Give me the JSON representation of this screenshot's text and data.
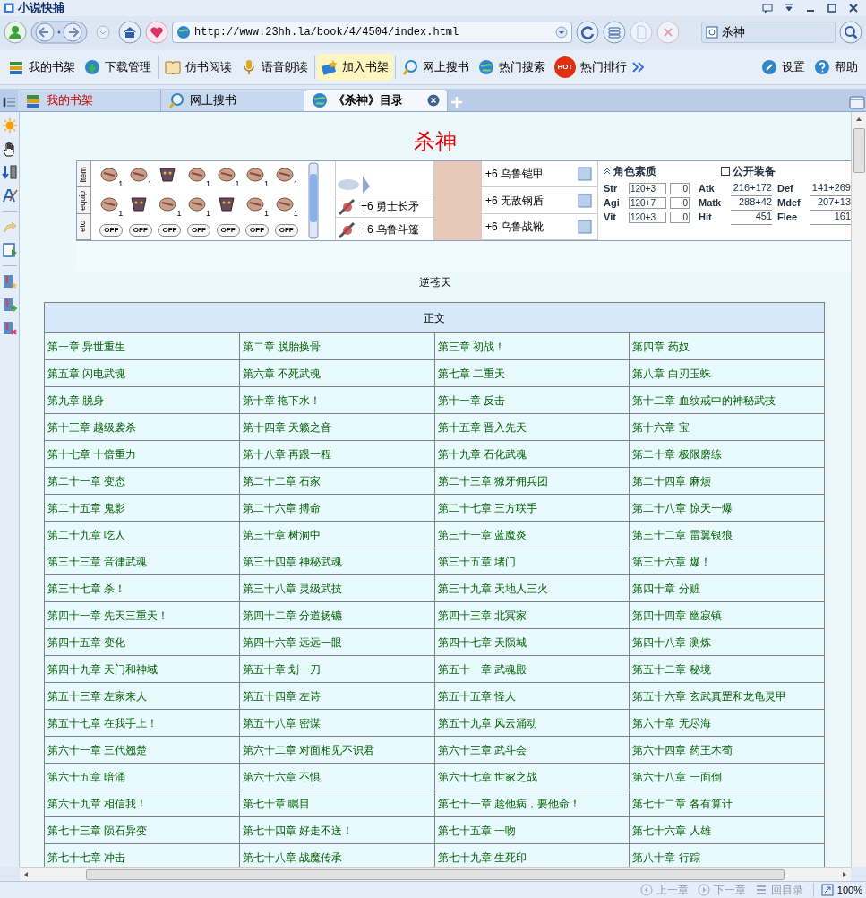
{
  "window": {
    "title": "小说快捕"
  },
  "nav": {
    "url": "http://www.23hh.la/book/4/4504/index.html",
    "search_value": "杀神"
  },
  "toolbar": {
    "left": [
      {
        "label": "我的书架",
        "kind": "books",
        "highlighted": false
      },
      {
        "label": "下载管理",
        "kind": "download",
        "highlighted": false
      },
      {
        "label": "仿书阅读",
        "kind": "reader",
        "highlighted": false
      },
      {
        "label": "语音朗读",
        "kind": "voice",
        "highlighted": false
      },
      {
        "label": "加入书架",
        "kind": "add",
        "highlighted": true
      },
      {
        "label": "网上搜书",
        "kind": "search",
        "highlighted": false
      },
      {
        "label": "热门搜索",
        "kind": "globe",
        "highlighted": false
      },
      {
        "label": "热门排行",
        "kind": "hot",
        "badge": "HOT",
        "highlighted": false
      }
    ],
    "right": [
      {
        "label": "设置",
        "kind": "settings"
      },
      {
        "label": "帮助",
        "kind": "help"
      }
    ]
  },
  "tabs": [
    {
      "label": "我的书架",
      "kind": "books",
      "selected": false,
      "color": "#d40000"
    },
    {
      "label": "网上搜书",
      "kind": "search",
      "selected": false
    },
    {
      "label": "《杀神》目录",
      "kind": "globe",
      "selected": true
    }
  ],
  "page": {
    "title": "杀神",
    "banner": {
      "side_tabs": [
        "item",
        "equip",
        "etc"
      ],
      "slots": [
        [
          {
            "kind": "stack",
            "count": "1"
          },
          {
            "kind": "stack",
            "count": "1"
          },
          {
            "kind": "single"
          },
          {
            "kind": "stack",
            "count": "1"
          },
          {
            "kind": "stack",
            "count": "1"
          },
          {
            "kind": "stack",
            "count": "1"
          },
          {
            "kind": "stack",
            "count": "1"
          }
        ],
        [
          {
            "kind": "stack",
            "count": "1"
          },
          {
            "kind": "single"
          },
          {
            "kind": "stack",
            "count": "1"
          },
          {
            "kind": "stack",
            "count": "1"
          },
          {
            "kind": "single"
          },
          {
            "kind": "stack",
            "count": "1"
          },
          {
            "kind": "stack",
            "count": "1"
          }
        ]
      ],
      "off_buttons": [
        "OFF",
        "OFF",
        "OFF",
        "OFF",
        "OFF",
        "OFF",
        "OFF"
      ],
      "left_gear": [
        "+6 勇士长矛",
        "+6 乌鲁斗篷"
      ],
      "right_gear": [
        "+6 乌鲁铠甲",
        "+6 无敌钢盾",
        "+6 乌鲁战靴"
      ],
      "stats_title": "角色素质",
      "public_label": "公开装备",
      "base_stats": [
        {
          "name": "Str",
          "value": "120+3",
          "bonus": "0"
        },
        {
          "name": "Agi",
          "value": "120+7",
          "bonus": "0"
        },
        {
          "name": "Vit",
          "value": "120+3",
          "bonus": "0"
        }
      ],
      "derived_stats": [
        [
          {
            "name": "Atk",
            "value": "216+172"
          },
          {
            "name": "Def",
            "value": "141+269"
          }
        ],
        [
          {
            "name": "Matk",
            "value": "288+42"
          },
          {
            "name": "Mdef",
            "value": "207+13"
          }
        ],
        [
          {
            "name": "Hit",
            "value": "451"
          },
          {
            "name": "Flee",
            "value": "161"
          }
        ]
      ]
    },
    "author": "逆苍天",
    "table": {
      "heading": "正文",
      "rows": [
        [
          "第一章 异世重生",
          "第二章 脱胎换骨",
          "第三章 初战！",
          "第四章 药奴"
        ],
        [
          "第五章 闪电武魂",
          "第六章 不死武魂",
          "第七章 二重天",
          "第八章 白刃玉蛛"
        ],
        [
          "第九章 脱身",
          "第十章 拖下水！",
          "第十一章 反击",
          "第十二章 血纹戒中的神秘武技"
        ],
        [
          "第十三章 越级袭杀",
          "第十四章 天籁之音",
          "第十五章 晋入先天",
          "第十六章 宝"
        ],
        [
          "第十七章 十倍重力",
          "第十八章 再跟一程",
          "第十九章 石化武魂",
          "第二十章 极限磨练"
        ],
        [
          "第二十一章 变态",
          "第二十二章 石家",
          "第二十三章 獠牙佣兵团",
          "第二十四章 麻烦"
        ],
        [
          "第二十五章 鬼影",
          "第二十六章 搏命",
          "第二十七章 三方联手",
          "第二十八章 惊天一爆"
        ],
        [
          "第二十九章 吃人",
          "第三十章 树洞中",
          "第三十一章 蓝魔炎",
          "第三十二章 雷翼银狼"
        ],
        [
          "第三十三章 音律武魂",
          "第三十四章 神秘武魂",
          "第三十五章 堵门",
          "第三十六章 爆！"
        ],
        [
          "第三十七章 杀！",
          "第三十八章 灵级武技",
          "第三十九章 天地人三火",
          "第四十章 分赃"
        ],
        [
          "第四十一章 先天三重天！",
          "第四十二章 分道扬镳",
          "第四十三章 北冥家",
          "第四十四章 幽寂镇"
        ],
        [
          "第四十五章 变化",
          "第四十六章 远远一眼",
          "第四十七章 天陨城",
          "第四十八章 测炼"
        ],
        [
          "第四十九章 天门和神域",
          "第五十章 划一刀",
          "第五十一章 武魂殿",
          "第五十二章 秘境"
        ],
        [
          "第五十三章 左家来人",
          "第五十四章 左诗",
          "第五十五章 怪人",
          "第五十六章 玄武真罡和龙龟灵甲"
        ],
        [
          "第五十七章 在我手上！",
          "第五十八章 密谋",
          "第五十九章 风云涌动",
          "第六十章 无尽海"
        ],
        [
          "第六十一章 三代翘楚",
          "第六十二章 对面相见不识君",
          "第六十三章 武斗会",
          "第六十四章 药王木荀"
        ],
        [
          "第六十五章 暗涌",
          "第六十六章 不惧",
          "第六十七章 世家之战",
          "第六十八章 一面倒"
        ],
        [
          "第六十九章 相信我！",
          "第七十章 瞩目",
          "第七十一章 趁他病，要他命！",
          "第七十二章 各有算计"
        ],
        [
          "第七十三章 陨石异变",
          "第七十四章 好走不送！",
          "第七十五章 一吻",
          "第七十六章 人雄"
        ],
        [
          "第七十七章 冲击",
          "第七十八章 战魔传承",
          "第七十九章 生死印",
          "第八十章 行踪"
        ]
      ]
    }
  },
  "status_bar": {
    "buttons": [
      {
        "label": "上一章",
        "kind": "prev"
      },
      {
        "label": "下一章",
        "kind": "next"
      },
      {
        "label": "回目录",
        "kind": "list"
      }
    ],
    "zoom": "100%"
  }
}
